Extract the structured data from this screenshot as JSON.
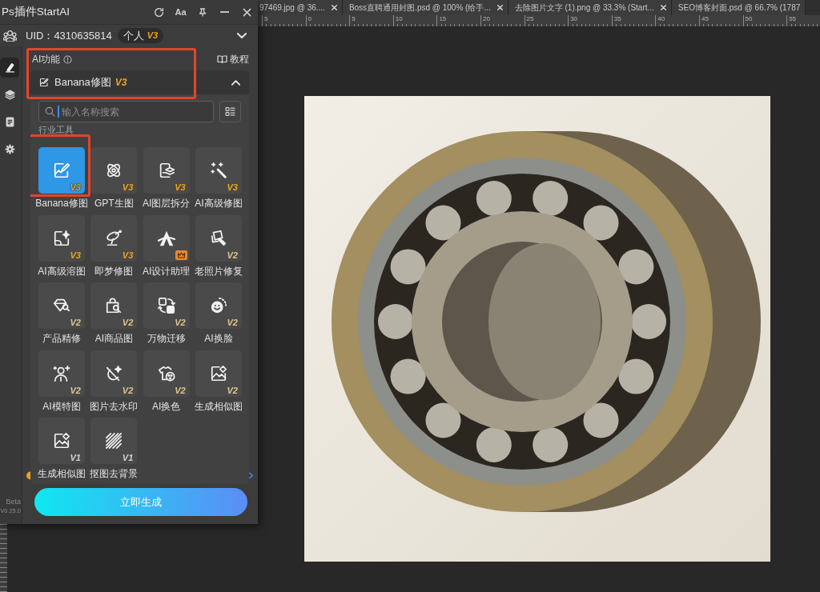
{
  "document_tabs": [
    {
      "title": "97469.jpg @ 36...."
    },
    {
      "title": "Boss直聘通用封图.psd @ 100% (给手..."
    },
    {
      "title": "去除图片文字 (1).png @ 33.3% (Start..."
    },
    {
      "title": "SEO博客封面.psd @ 66.7% (1787"
    }
  ],
  "ruler": {
    "labels": [
      "5",
      "0",
      "5",
      "10",
      "15",
      "20",
      "25",
      "30",
      "35",
      "40",
      "45",
      "50",
      "55"
    ]
  },
  "plugin_panel": {
    "title": "Ps插件StartAI",
    "title_buttons": [
      {
        "kind": "refresh"
      },
      {
        "kind": "text",
        "label": "Aa"
      },
      {
        "kind": "pin"
      },
      {
        "kind": "minimize"
      },
      {
        "kind": "close"
      }
    ],
    "account": {
      "uid": "UID：4310635814",
      "plan": "个人",
      "plan_version": "V3",
      "expanded": false
    },
    "sidebar": {
      "items": [
        {
          "selected": true
        },
        {
          "selected": false
        },
        {
          "selected": false
        },
        {
          "selected": false
        }
      ]
    },
    "section_title": "AI功能",
    "tutorial_link": "教程",
    "feature_selector": {
      "label": "Banana修图",
      "version": "V3",
      "expanded": true,
      "highlighted": true
    },
    "search": {
      "placeholder": "输入名称搜索",
      "focused": true
    },
    "group_title": "行业工具",
    "tools": [
      {
        "label": "Banana修图",
        "badge": {
          "kind": "text",
          "text": "V3",
          "color": "#f0a21e"
        },
        "selected": true,
        "highlighted": true
      },
      {
        "label": "GPT生图",
        "badge": {
          "kind": "text",
          "text": "V3",
          "color": "#f0a21e"
        },
        "selected": false,
        "highlighted": false
      },
      {
        "label": "AI图层拆分",
        "badge": {
          "kind": "text",
          "text": "V3",
          "color": "#f0a21e"
        },
        "selected": false,
        "highlighted": false
      },
      {
        "label": "AI高级修图",
        "badge": {
          "kind": "text",
          "text": "V3",
          "color": "#f0a21e"
        },
        "selected": false,
        "highlighted": false
      },
      {
        "label": "AI高级溶图",
        "badge": {
          "kind": "text",
          "text": "V3",
          "color": "#f0a21e"
        },
        "selected": false,
        "highlighted": false
      },
      {
        "label": "即梦修图",
        "badge": {
          "kind": "text",
          "text": "V3",
          "color": "#f0a21e"
        },
        "selected": false,
        "highlighted": false
      },
      {
        "label": "AI设计助理",
        "badge": {
          "kind": "crown",
          "color": "#e8892c"
        },
        "selected": false,
        "highlighted": false
      },
      {
        "label": "老照片修复",
        "badge": {
          "kind": "text",
          "text": "V2",
          "color": "#dcc48e"
        },
        "selected": false,
        "highlighted": false
      },
      {
        "label": "产品精修",
        "badge": {
          "kind": "text",
          "text": "V2",
          "color": "#dcc48e"
        },
        "selected": false,
        "highlighted": false
      },
      {
        "label": "AI商品图",
        "badge": {
          "kind": "text",
          "text": "V2",
          "color": "#dcc48e"
        },
        "selected": false,
        "highlighted": false
      },
      {
        "label": "万物迁移",
        "badge": {
          "kind": "text",
          "text": "V2",
          "color": "#dcc48e"
        },
        "selected": false,
        "highlighted": false
      },
      {
        "label": "AI换脸",
        "badge": {
          "kind": "text",
          "text": "V2",
          "color": "#dcc48e"
        },
        "selected": false,
        "highlighted": false
      },
      {
        "label": "AI模特图",
        "badge": {
          "kind": "text",
          "text": "V2",
          "color": "#dcc48e"
        },
        "selected": false,
        "highlighted": false
      },
      {
        "label": "图片去水印",
        "badge": {
          "kind": "text",
          "text": "V2",
          "color": "#dcc48e"
        },
        "selected": false,
        "highlighted": false
      },
      {
        "label": "AI换色",
        "badge": {
          "kind": "text",
          "text": "V2",
          "color": "#dcc48e"
        },
        "selected": false,
        "highlighted": false
      },
      {
        "label": "生成相似图",
        "badge": {
          "kind": "text",
          "text": "V2",
          "color": "#dcc48e"
        },
        "selected": false,
        "highlighted": false
      },
      {
        "label": "生成相似图",
        "badge": {
          "kind": "text",
          "text": "V1",
          "color": "#cfcfcf"
        },
        "selected": false,
        "highlighted": false
      },
      {
        "label": "抠图去背景",
        "badge": {
          "kind": "text",
          "text": "V1",
          "color": "#cfcfcf"
        },
        "selected": false,
        "highlighted": false
      }
    ],
    "generate_button": "立即生成",
    "build": {
      "channel": "Beta",
      "version": "V0.25.0"
    }
  }
}
